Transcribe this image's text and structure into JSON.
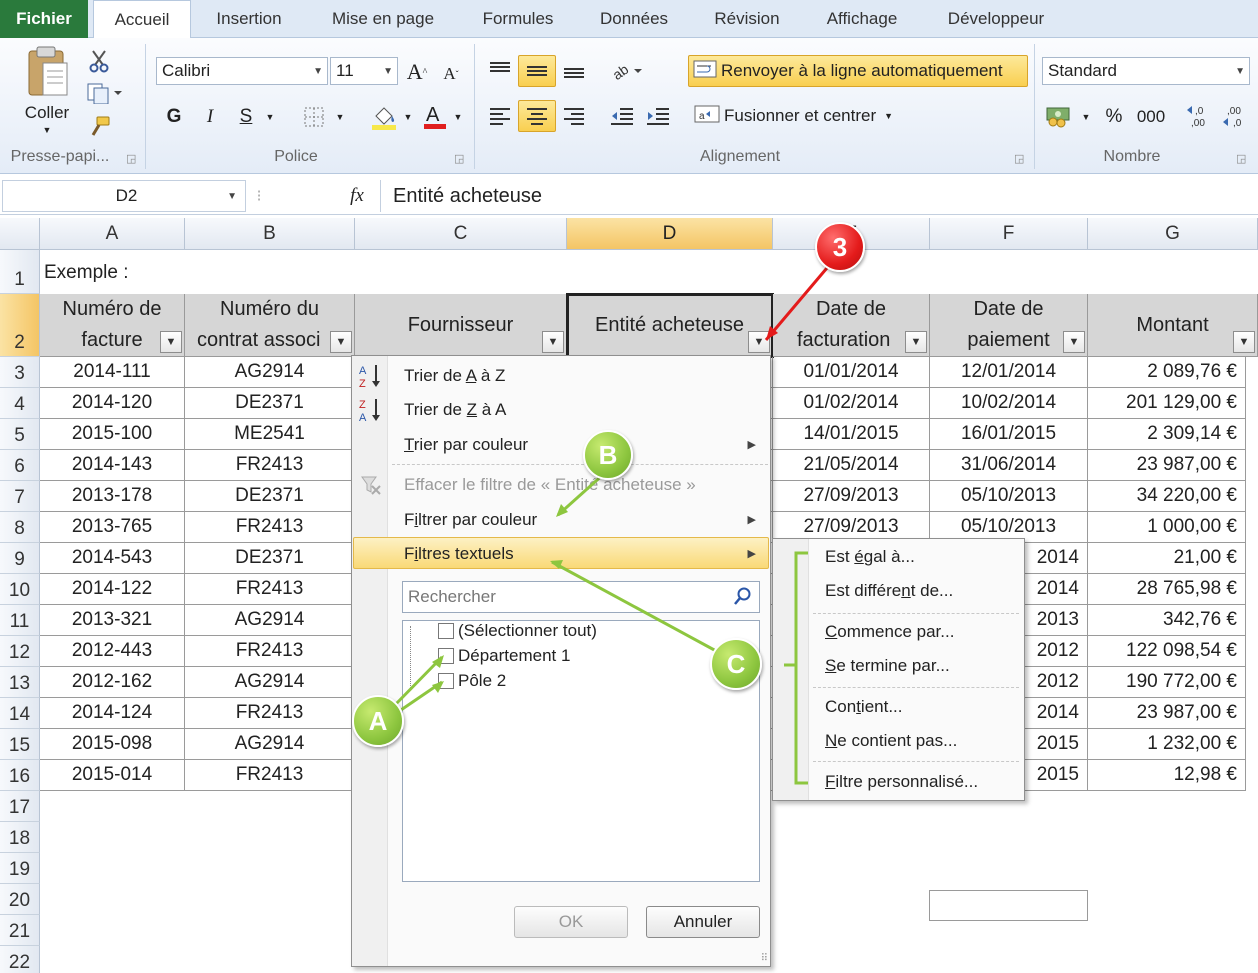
{
  "tabs": [
    "Fichier",
    "Accueil",
    "Insertion",
    "Mise en page",
    "Formules",
    "Données",
    "Révision",
    "Affichage",
    "Développeur"
  ],
  "ribbon": {
    "paste_label": "Coller",
    "font_name": "Calibri",
    "font_size": "11",
    "bold": "G",
    "italic": "I",
    "underline": "S",
    "wrap_text": "Renvoyer à la ligne automatiquement",
    "merge_center": "Fusionner et centrer",
    "number_format": "Standard",
    "percent": "%",
    "thousands": "000",
    "groups": {
      "clipboard": "Presse-papi...",
      "font": "Police",
      "alignment": "Alignement",
      "number": "Nombre"
    }
  },
  "formula_bar": {
    "name_box": "D2",
    "fx": "fx",
    "content": "Entité acheteuse"
  },
  "columns": [
    "A",
    "B",
    "C",
    "D",
    "E",
    "F",
    "G"
  ],
  "rows": [
    "1",
    "2",
    "3",
    "4",
    "5",
    "6",
    "7",
    "8",
    "9",
    "10",
    "11",
    "12",
    "13",
    "14",
    "15",
    "16",
    "17",
    "18",
    "19",
    "20",
    "21",
    "22"
  ],
  "sheet": {
    "title": "Exemple :",
    "headers": {
      "a1": "Numéro de",
      "a2": "facture",
      "b1": "Numéro du",
      "b2": "contrat associ",
      "c": "Fournisseur",
      "d": "Entité acheteuse",
      "e1": "Date de",
      "e2": "facturation",
      "f1": "Date de",
      "f2": "paiement",
      "g": "Montant"
    },
    "col_a": [
      "2014-111",
      "2014-120",
      "2015-100",
      "2014-143",
      "2013-178",
      "2013-765",
      "2014-543",
      "2014-122",
      "2013-321",
      "2012-443",
      "2012-162",
      "2014-124",
      "2015-098",
      "2015-014"
    ],
    "col_b": [
      "AG2914",
      "DE2371",
      "ME2541",
      "FR2413",
      "DE2371",
      "FR2413",
      "DE2371",
      "FR2413",
      "AG2914",
      "FR2413",
      "AG2914",
      "FR2413",
      "AG2914",
      "FR2413"
    ],
    "col_e": [
      "01/01/2014",
      "01/02/2014",
      "14/01/2015",
      "21/05/2014",
      "27/09/2013",
      "27/09/2013"
    ],
    "col_f": [
      "12/01/2014",
      "10/02/2014",
      "16/01/2015",
      "31/06/2014",
      "05/10/2013",
      "05/10/2013",
      "2014",
      "2014",
      "2013",
      "2012",
      "2012",
      "2014",
      "2015",
      "2015"
    ],
    "col_g": [
      "2 089,76 €",
      "201 129,00 €",
      "2 309,14 €",
      "23 987,00 €",
      "34 220,00 €",
      "1 000,00 €",
      "21,00 €",
      "28 765,98 €",
      "342,76 €",
      "122 098,54 €",
      "190 772,00 €",
      "23 987,00 €",
      "1 232,00 €",
      "12,98 €"
    ]
  },
  "menu": {
    "sort_az": {
      "pre": "Trier de ",
      "u": "A",
      "post": " à Z"
    },
    "sort_za": {
      "pre": "Trier de ",
      "u": "Z",
      "post": " à A"
    },
    "sort_color": {
      "pre": "",
      "u": "T",
      "post": "rier par couleur"
    },
    "clear_filter": "Effacer le filtre de « Entité acheteuse »",
    "filter_color": {
      "pre": "F",
      "u": "i",
      "post": "ltrer par couleur"
    },
    "text_filters": {
      "pre": "F",
      "u": "i",
      "post": "ltres textuels"
    },
    "search_placeholder": "Rechercher",
    "items": [
      "(Sélectionner tout)",
      "Département 1",
      "Pôle 2"
    ],
    "ok": "OK",
    "cancel": "Annuler"
  },
  "submenu": [
    {
      "pre": "Est ",
      "u": "é",
      "post": "gal à..."
    },
    {
      "pre": "Est différe",
      "u": "n",
      "post": "t de..."
    },
    {
      "pre": "",
      "u": "C",
      "post": "ommence par..."
    },
    {
      "pre": "",
      "u": "S",
      "post": "e termine par..."
    },
    {
      "pre": "Con",
      "u": "t",
      "post": "ient..."
    },
    {
      "pre": "",
      "u": "N",
      "post": "e contient pas..."
    },
    {
      "pre": "",
      "u": "F",
      "post": "iltre personnalisé..."
    }
  ],
  "annotations": {
    "red": "3",
    "b": "B",
    "c": "C",
    "a": "A"
  },
  "colors": {
    "file_tab": "#2a7a3c",
    "selected_header": "#f4c565",
    "header_fill": "#d6d6d6",
    "annotation_green": "#8dc63f",
    "annotation_red": "#e41b1b"
  }
}
